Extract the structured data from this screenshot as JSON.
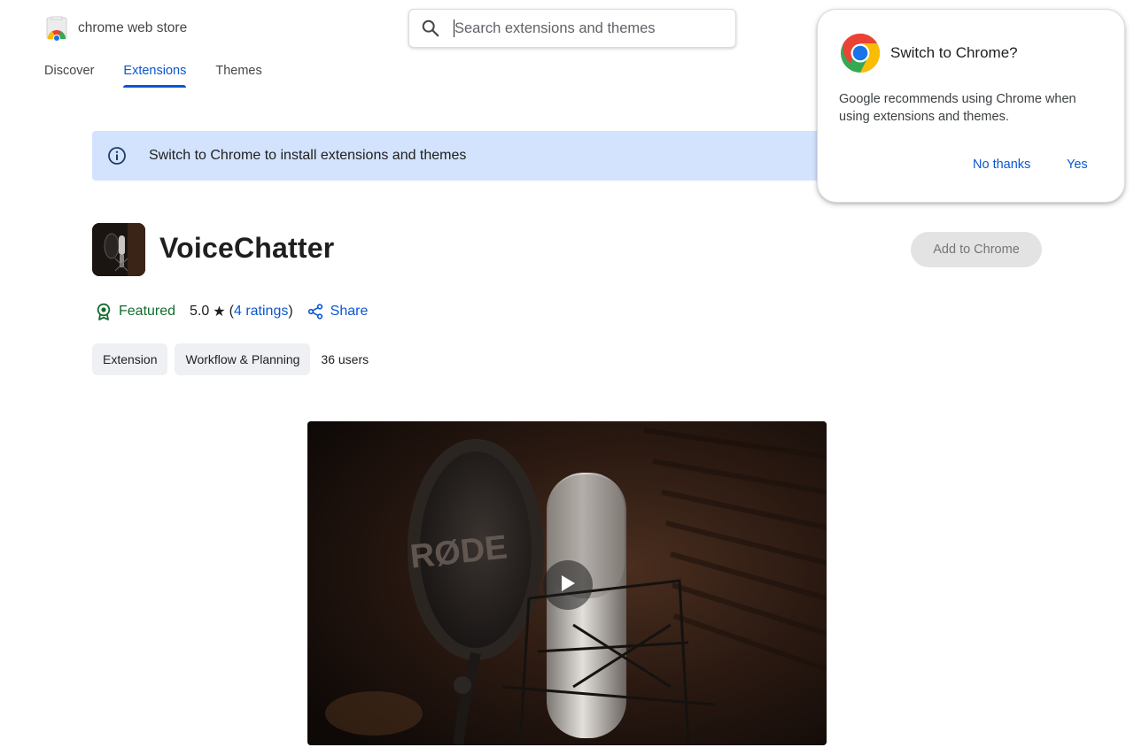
{
  "store": {
    "name": "chrome web store",
    "logo_icon": "chrome-web-store-icon"
  },
  "search": {
    "placeholder": "Search extensions and themes",
    "value": "",
    "icon": "search-icon"
  },
  "nav": {
    "tabs": [
      {
        "label": "Discover",
        "active": false
      },
      {
        "label": "Extensions",
        "active": true
      },
      {
        "label": "Themes",
        "active": false
      }
    ]
  },
  "banner": {
    "text": "Switch to Chrome to install extensions and themes",
    "icon": "info-icon",
    "color": "#d3e3fd"
  },
  "extension": {
    "title": "VoiceChatter",
    "add_button": "Add to Chrome",
    "featured_label": "Featured",
    "rating": "5.0",
    "star": "★",
    "ratings_open": "(",
    "ratings_link": "4 ratings",
    "ratings_close": ")",
    "share_label": "Share",
    "chips": [
      "Extension",
      "Workflow & Planning"
    ],
    "users": "36 users",
    "media_logo": "RØDE"
  },
  "popup": {
    "title": "Switch to Chrome?",
    "body": "Google recommends using Chrome when using extensions and themes.",
    "no_label": "No thanks",
    "yes_label": "Yes"
  },
  "colors": {
    "accent": "#0b57d0",
    "featured": "#146c2e"
  }
}
